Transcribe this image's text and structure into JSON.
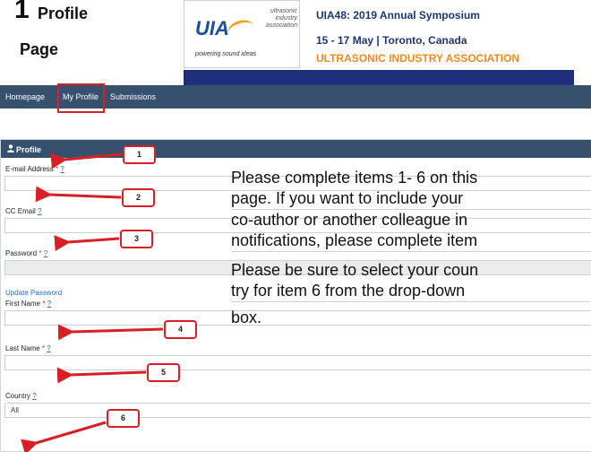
{
  "page_heading": {
    "number": "1",
    "word1": "Profile",
    "word2": "Page"
  },
  "banner": {
    "logo_text": "UIA",
    "logo_subtitle": "ultrasonic industry association",
    "logo_tagline": "powering sound ideas",
    "line1": "UIA48: 2019 Annual Symposium",
    "line2": "15 - 17 May | Toronto, Canada",
    "line3": "ULTRASONIC INDUSTRY ASSOCIATION"
  },
  "nav": {
    "items": [
      "Homepage",
      "My Profile",
      "Submissions"
    ]
  },
  "panel": {
    "title": "Profile"
  },
  "form": {
    "help_mark": "?",
    "required_mark": "*",
    "email": {
      "label": "E-mail Address",
      "value": ""
    },
    "cc_email": {
      "label": "CC Email",
      "value": ""
    },
    "password": {
      "label": "Password",
      "value": ""
    },
    "update_password": "Update Password",
    "first_name": {
      "label": "First Name",
      "value": ""
    },
    "last_name": {
      "label": "Last Name",
      "value": ""
    },
    "country": {
      "label": "Country",
      "value": "All"
    }
  },
  "callouts": [
    "1",
    "2",
    "3",
    "4",
    "5",
    "6"
  ],
  "instructions": {
    "lines": [
      "Please complete items 1- 6 on this",
      "page.  If you want to include your",
      "co-author or another colleague in",
      "notifications, please complete item",
      "Please be sure to select your coun",
      "try for item 6 from the drop-down",
      "box."
    ]
  },
  "colors": {
    "navbar": "#36506e",
    "annotation_red": "#d81f26",
    "link_blue": "#2a6fbf",
    "banner_blue": "#1e2e7a",
    "banner_orange": "#f08a1c"
  }
}
